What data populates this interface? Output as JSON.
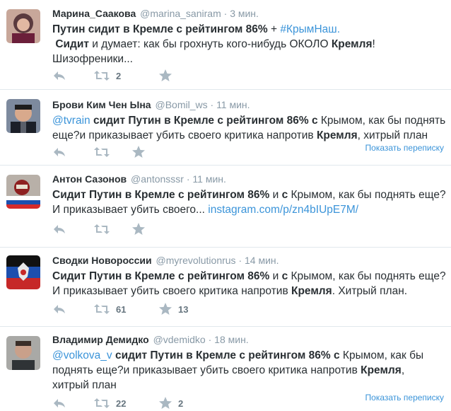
{
  "tweets": [
    {
      "fullname": "Марина_Саакова",
      "username": "@marina_saniram",
      "dot": "·",
      "time": "3 мин.",
      "line1": {
        "bold": "Путин сидит в Кремле с рейтингом 86%",
        "plus": " + ",
        "hashtag": "#КрымНаш."
      },
      "line2": {
        "lead": " ",
        "bold": "Сидит",
        "rest1": " и думает: как бы грохнуть кого-нибудь ОКОЛО ",
        "bold2": "Кремля",
        "rest2": "!"
      },
      "line3": "Шизофреники...",
      "retweets": "2",
      "favorites": ""
    },
    {
      "fullname": "Брови Ким Чен Ына",
      "username": "@Bomil_ws",
      "dot": "·",
      "time": "11 мин.",
      "line1": {
        "mention": "@tvrain",
        "bold": " сидит Путин в Кремле с рейтингом 86% с",
        "rest": " Крымом, как бы поднять"
      },
      "line2": {
        "pre": "еще?и приказывает убить своего критика напротив ",
        "bold": "Кремля",
        "rest": ", хитрый план"
      },
      "retweets": "",
      "favorites": "",
      "conversation": "Показать переписку"
    },
    {
      "fullname": "Антон Сазонов",
      "username": "@antonsssr",
      "dot": "·",
      "time": "11 мин.",
      "line1": {
        "bold": "Сидит Путин в Кремле с рейтингом 86%",
        "mid": " и ",
        "bold2": "с",
        "rest": " Крымом, как бы поднять еще?"
      },
      "line2": {
        "pre": "И приказывает убить своего... ",
        "link": "instagram.com/p/zn4bIUpE7M/"
      },
      "retweets": "",
      "favorites": ""
    },
    {
      "fullname": "Сводки Новороссии",
      "username": "@myrevolutionrus",
      "dot": "·",
      "time": "14 мин.",
      "line1": {
        "bold": "Сидит Путин в Кремле с рейтингом 86%",
        "mid": " и ",
        "bold2": "с",
        "rest": " Крымом, как бы поднять еще?"
      },
      "line2": {
        "pre": "И приказывает убить своего критика напротив ",
        "bold": "Кремля",
        "rest": ". Хитрый план."
      },
      "retweets": "61",
      "favorites": "13"
    },
    {
      "fullname": "Владимир Демидко",
      "username": "@vdemidko",
      "dot": "·",
      "time": "18 мин.",
      "line1": {
        "mention": "@volkova_v",
        "bold": " сидит Путин в Кремле с рейтингом 86% с",
        "rest": " Крымом, как бы"
      },
      "line2": {
        "pre": "поднять еще?и приказывает убить своего критика напротив ",
        "bold": "Кремля",
        "rest": ","
      },
      "line3": "хитрый план",
      "retweets": "22",
      "favorites": "2",
      "conversation": "Показать переписку"
    }
  ],
  "colors": {
    "link": "#3b94d9",
    "meta": "#8899a6",
    "text": "#292f33",
    "divider": "#e1e8ed"
  },
  "icons": {
    "reply": "reply-icon",
    "retweet": "retweet-icon",
    "favorite": "star-icon"
  }
}
